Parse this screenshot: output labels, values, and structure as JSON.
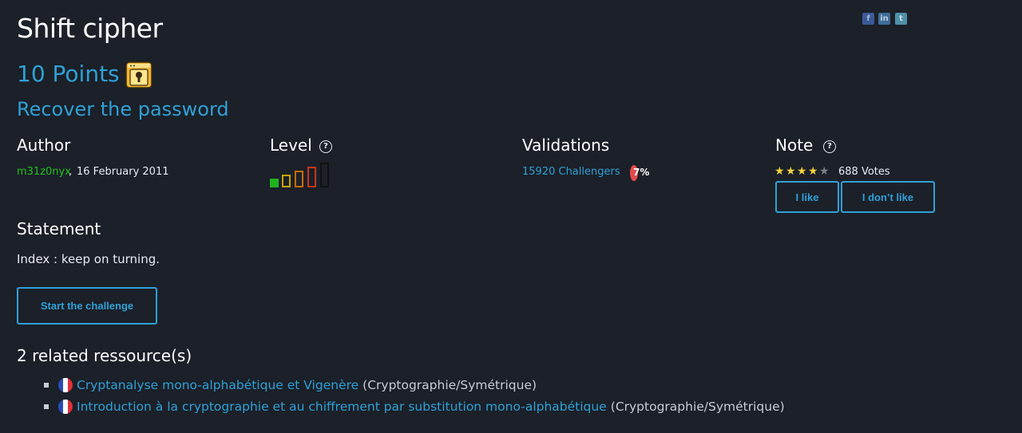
{
  "challenge": {
    "title": "Shift cipher",
    "points": "10 Points",
    "subtitle": "Recover the password"
  },
  "social": {
    "facebook": "f",
    "linkedin": "in",
    "twitter": "t"
  },
  "author": {
    "heading": "Author",
    "name": "m31z0nyx",
    "separator": ",",
    "date": "16 February 2011"
  },
  "level": {
    "heading": "Level",
    "help": "?",
    "value": 1,
    "max": 5,
    "colors": [
      "#1fb21f",
      "#c9a400",
      "#c96b00",
      "#c9361a",
      "#1a1a1a"
    ]
  },
  "validations": {
    "heading": "Validations",
    "challengers": "15920 Challengers",
    "percent": "7%"
  },
  "note": {
    "heading": "Note",
    "help": "?",
    "stars": 4,
    "max_stars": 5,
    "votes": "688 Votes",
    "like": "I like",
    "dislike": "I don’t like",
    "star_color": "#f2d03b",
    "star_empty_color": "#7a7f87"
  },
  "statement": {
    "heading": "Statement",
    "text": "Index : keep on turning."
  },
  "start_button": "Start the challenge",
  "resources": {
    "heading": "2 related ressource(s)",
    "items": [
      {
        "flag": "fr",
        "title": "Cryptanalyse mono-alphabétique et Vigenère",
        "category": "(Cryptographie/Symétrique)"
      },
      {
        "flag": "fr",
        "title": "Introduction à la cryptographie et au chiffrement par substitution mono-alphabétique",
        "category": "(Cryptographie/Symétrique)"
      }
    ]
  },
  "colors": {
    "background": "#1b2029",
    "accent": "#2fa1d6",
    "author_green": "#22c01d",
    "percent_red": "#e14b4b"
  }
}
